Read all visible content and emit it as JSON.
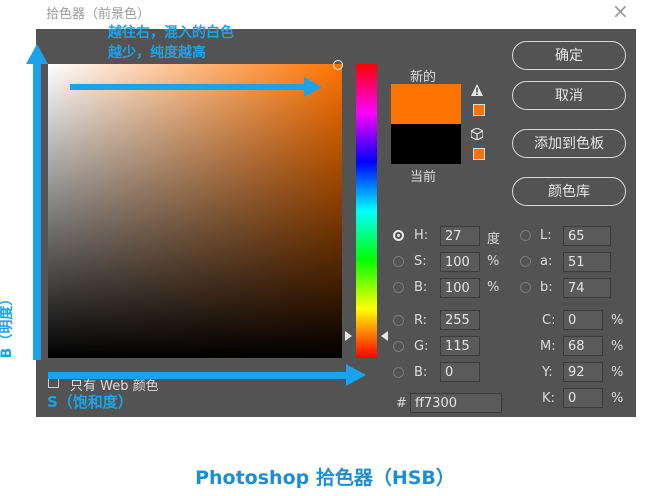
{
  "window": {
    "title": "拾色器（前景色）",
    "close_label": "×"
  },
  "annotations": {
    "top_line1": "越往右，混入的白色",
    "top_line2": "越少，纯度越高",
    "left_axis": "B（明度）",
    "bottom_axis": "S（饱和度）"
  },
  "swatches": {
    "new_label": "新的",
    "current_label": "当前",
    "new_color": "#ff7300",
    "current_color": "#000000"
  },
  "buttons": {
    "ok": "确定",
    "cancel": "取消",
    "add_swatches": "添加到色板",
    "color_libraries": "颜色库"
  },
  "hsb": {
    "h": {
      "label": "H:",
      "value": "27",
      "unit": "度"
    },
    "s": {
      "label": "S:",
      "value": "100",
      "unit": "%"
    },
    "b": {
      "label": "B:",
      "value": "100",
      "unit": "%"
    }
  },
  "lab": {
    "l": {
      "label": "L:",
      "value": "65"
    },
    "a": {
      "label": "a:",
      "value": "51"
    },
    "b": {
      "label": "b:",
      "value": "74"
    }
  },
  "rgb": {
    "r": {
      "label": "R:",
      "value": "255"
    },
    "g": {
      "label": "G:",
      "value": "115"
    },
    "b": {
      "label": "B:",
      "value": "0"
    }
  },
  "cmyk": {
    "c": {
      "label": "C:",
      "value": "0",
      "unit": "%"
    },
    "m": {
      "label": "M:",
      "value": "68",
      "unit": "%"
    },
    "y": {
      "label": "Y:",
      "value": "92",
      "unit": "%"
    },
    "k": {
      "label": "K:",
      "value": "0",
      "unit": "%"
    }
  },
  "hex": {
    "label": "#",
    "value": "ff7300"
  },
  "web_only": {
    "label": "只有 Web 颜色"
  },
  "caption": "Photoshop 拾色器（HSB）",
  "colors": {
    "accent": "#1aa3e8",
    "dialog_bg": "#535353"
  }
}
